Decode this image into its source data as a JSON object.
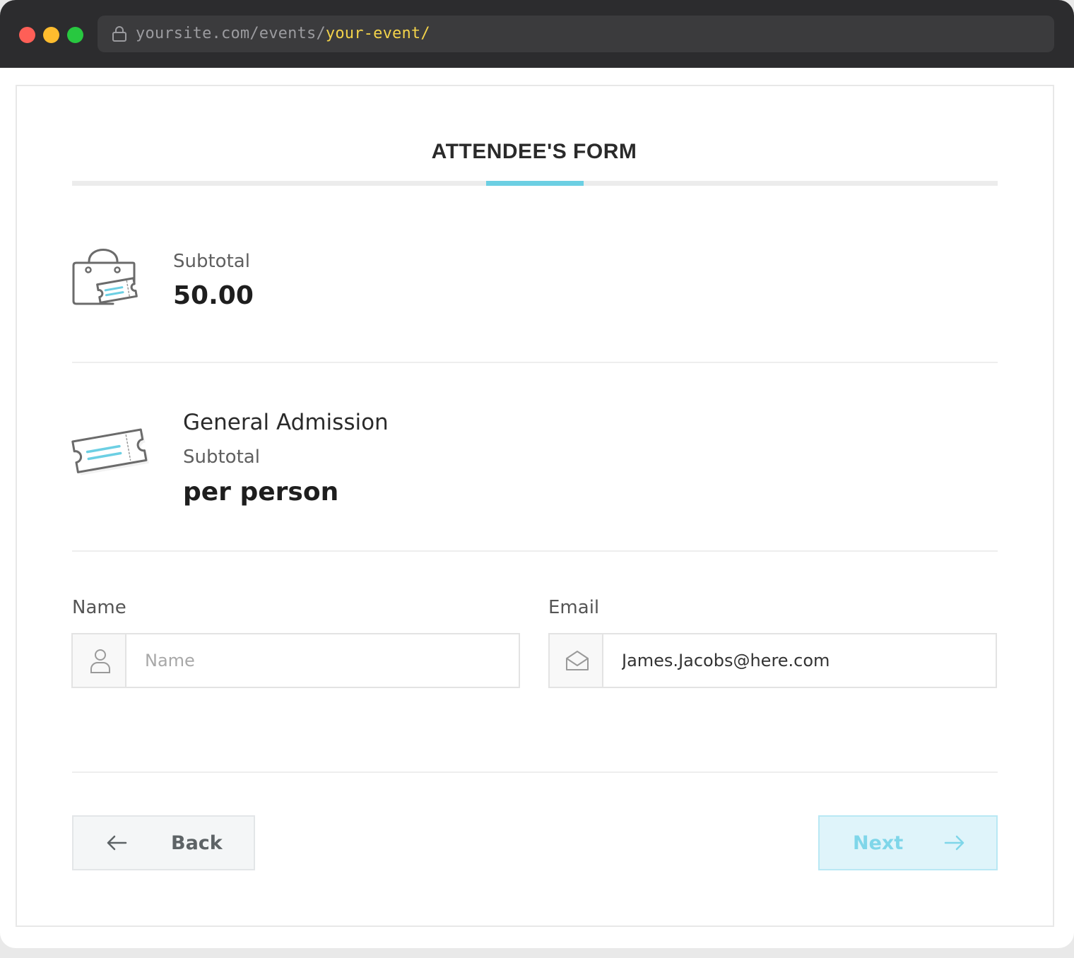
{
  "browser": {
    "url_prefix": "yoursite.com/events/",
    "url_highlight": "your-event/"
  },
  "form": {
    "title": "ATTENDEE'S FORM",
    "progress": 0.5
  },
  "order": {
    "subtotal_label": "Subtotal",
    "subtotal_value": "50.00"
  },
  "ticket": {
    "name": "General Admission",
    "subtotal_label": "Subtotal",
    "price_text": "per person"
  },
  "fields": {
    "name": {
      "label": "Name",
      "placeholder": "Name",
      "value": ""
    },
    "email": {
      "label": "Email",
      "placeholder": "",
      "value": "James.Jacobs@here.com"
    }
  },
  "buttons": {
    "back": "Back",
    "next": "Next"
  },
  "icons": {
    "lock": "lock-icon",
    "bag": "shopping-bag-ticket-icon",
    "ticket": "ticket-icon",
    "user": "user-icon",
    "mail": "envelope-open-icon",
    "back_arrow": "arrow-left-icon",
    "next_arrow": "arrow-right-icon"
  },
  "colors": {
    "accent": "#6ccfe3",
    "url_highlight": "#f3d34a",
    "next_bg": "#dff4fa"
  }
}
